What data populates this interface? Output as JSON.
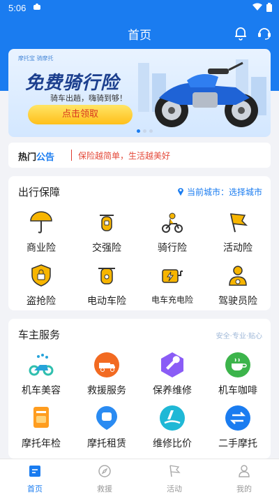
{
  "status": {
    "time": "5:06"
  },
  "header": {
    "title": "首页"
  },
  "banner": {
    "brand": "摩托宝 骑摩托",
    "headline": "免费骑行险",
    "subtitle": "骑车出趟，嗨骑到够！",
    "cta": "点击领取"
  },
  "notice": {
    "tag_a": "热门",
    "tag_b": "公告",
    "message": "保险越简单，生活越美好"
  },
  "travel": {
    "title": "出行保障",
    "city_label": "当前城市：选择城市",
    "items": [
      {
        "label": "商业险",
        "icon": "umbrella-icon"
      },
      {
        "label": "交强险",
        "icon": "scooter-icon"
      },
      {
        "label": "骑行险",
        "icon": "rider-icon"
      },
      {
        "label": "活动险",
        "icon": "flag-icon"
      },
      {
        "label": "盗抢险",
        "icon": "lock-shield-icon"
      },
      {
        "label": "电动车险",
        "icon": "ebike-icon"
      },
      {
        "label": "电车充电险",
        "icon": "charging-icon"
      },
      {
        "label": "驾驶员险",
        "icon": "driver-icon"
      }
    ]
  },
  "services": {
    "title": "车主服务",
    "tagline": "安全·专业·贴心",
    "items": [
      {
        "label": "机车美容",
        "icon": "motorbike-wash-icon"
      },
      {
        "label": "救援服务",
        "icon": "tow-truck-icon"
      },
      {
        "label": "保养维修",
        "icon": "wrench-icon"
      },
      {
        "label": "机车咖啡",
        "icon": "coffee-icon"
      },
      {
        "label": "摩托年检",
        "icon": "inspection-icon"
      },
      {
        "label": "摩托租赁",
        "icon": "rent-icon"
      },
      {
        "label": "维修比价",
        "icon": "compare-icon"
      },
      {
        "label": "二手摩托",
        "icon": "used-exchange-icon"
      }
    ]
  },
  "tabs": [
    {
      "label": "首页",
      "icon": "home-icon",
      "active": true
    },
    {
      "label": "救援",
      "icon": "compass-icon",
      "active": false
    },
    {
      "label": "活动",
      "icon": "flag-outline-icon",
      "active": false
    },
    {
      "label": "我的",
      "icon": "person-icon",
      "active": false
    }
  ],
  "colors": {
    "primary": "#1a7cf0",
    "notice_red": "#e44a3a",
    "cta_yellow": "#ffbf1a"
  }
}
